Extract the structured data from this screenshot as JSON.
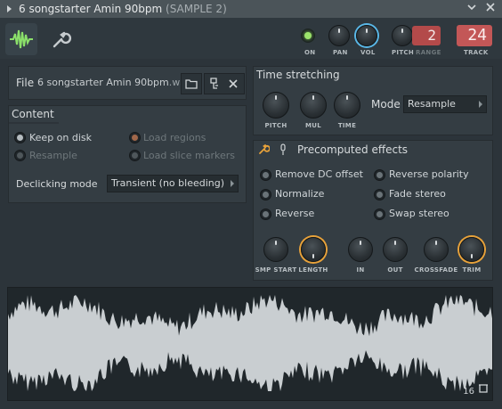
{
  "window": {
    "title": "6 songstarter Amin 90bpm",
    "subtitle": "(SAMPLE 2)",
    "buttons": [
      "menu-icon",
      "close-icon"
    ]
  },
  "toolbar": {
    "labels": {
      "on": "ON",
      "pan": "PAN",
      "vol": "VOL",
      "pitch": "PITCH",
      "range": "RANGE",
      "track": "TRACK"
    },
    "range_value": "2",
    "track_value": "24"
  },
  "file": {
    "label": "File",
    "name": "6 songstarter Amin 90bpm",
    "ext": ".wav"
  },
  "content": {
    "title": "Content",
    "options": [
      {
        "label": "Keep on disk",
        "state": "on"
      },
      {
        "label": "Load regions",
        "state": "disabled"
      },
      {
        "label": "Resample",
        "state": "disabled"
      },
      {
        "label": "Load slice markers",
        "state": "disabled"
      }
    ],
    "declick_label": "Declicking mode",
    "declick_value": "Transient (no bleeding)"
  },
  "time_stretching": {
    "title": "Time stretching",
    "knobs": [
      "PITCH",
      "MUL",
      "TIME"
    ],
    "mode_label": "Mode",
    "mode_value": "Resample"
  },
  "precomputed": {
    "title": "Precomputed effects",
    "options": [
      "Remove DC offset",
      "Reverse polarity",
      "Normalize",
      "Fade stereo",
      "Reverse",
      "Swap stereo"
    ],
    "knobs": [
      "SMP START",
      "LENGTH",
      "IN",
      "OUT",
      "CROSSFADE",
      "TRIM"
    ]
  },
  "waveform": {
    "count": "16"
  },
  "colors": {
    "accent_orange": "#e8a23a",
    "accent_blue": "#5ab8e8",
    "led_green": "#9be36b",
    "display_red": "#c35757",
    "waveform": "#c9ced1"
  }
}
